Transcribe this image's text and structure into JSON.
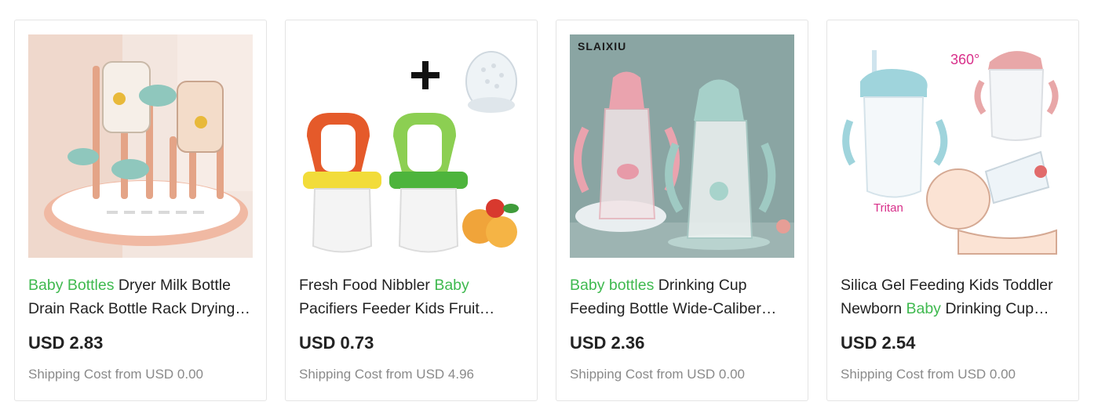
{
  "products": [
    {
      "title_pre": "",
      "title_kw": "Baby Bottles",
      "title_post": " Dryer Milk Bottle Drain Rack Bottle Rack Drying Rack Baby Supplies",
      "price": "USD 2.83",
      "shipping": "Shipping Cost from USD 0.00"
    },
    {
      "title_pre": "Fresh Food Nibbler ",
      "title_kw": "Baby",
      "title_post": " Pacifiers Feeder Kids Fruit Feeder Nipples Feeding Safe",
      "price": "USD 0.73",
      "shipping": "Shipping Cost from USD 4.96"
    },
    {
      "title_pre": "",
      "title_kw": "Baby bottles",
      "title_post": " Drinking Cup Feeding Bottle Wide-Caliber Straw Cup",
      "price": "USD 2.36",
      "shipping": "Shipping Cost from USD 0.00",
      "brand_text": "SLAIXIU"
    },
    {
      "title_pre": "Silica Gel Feeding Kids Toddler Newborn ",
      "title_kw": "Baby",
      "title_post": " Drinking Cup With Straw",
      "price": "USD 2.54",
      "shipping": "Shipping Cost from USD 0.00",
      "badge_360": "360°",
      "badge_tritan": "Tritan"
    }
  ],
  "colors": {
    "keyword": "#3fb94f",
    "text": "#222222",
    "muted": "#8a8a8a"
  }
}
